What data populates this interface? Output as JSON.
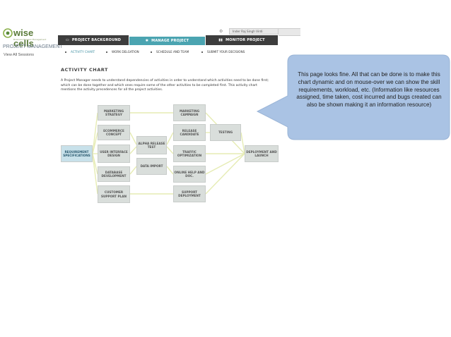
{
  "brand": {
    "logo_text": "wise cells",
    "tagline": "Business Process Management",
    "app_title": "PROJECT MANAGEMENT",
    "sessions_link": "View All Sessions"
  },
  "user": {
    "name": "Inder Raj Singh Virdi"
  },
  "tabs": [
    {
      "label": "PROJECT BACKGROUND",
      "icon": "monitor-icon"
    },
    {
      "label": "MANAGE PROJECT",
      "icon": "gear-icon"
    },
    {
      "label": "MONITOR PROJECT",
      "icon": "bar-chart-icon"
    }
  ],
  "subnav": [
    "ACTIVITY CHART",
    "WORK DELGATION",
    "SCHEDULE AND TEAM",
    "SUBMIT YOUR DECISIONS"
  ],
  "page": {
    "title": "ACTIVITY CHART",
    "description": "A Project Manager needs to understand dependencies of activities in order to understand which activities need to be done first; which can be done together and which ones require some of the other activities to be completed first. This activity chart mentions the activity precedences for all the project activities."
  },
  "activities": {
    "req": "REQUIREMENT SPECIFICATIONS",
    "mkt_strategy": "MARKETING STRATEGY",
    "ecom": "ECOMMERCE CONCEPT",
    "ui": "USER INTERFACE DESIGN",
    "db": "DATABASE DEVELOPMENT",
    "cust_support": "CUSTOMER SUPPORT PLAN",
    "alpha": "ALPHA RELEASE TEST",
    "data_import": "DATA IMPORT",
    "mkt_campaign": "MARKETING CAMPAIGN",
    "release": "RELEASE CANDIDATE",
    "traffic": "TRAFFIC OPTIMIZATION",
    "online_help": "ONLINE HELP AND DOC.",
    "support_deploy": "SUPPORT DEPLOYMENT",
    "testing": "TESTING",
    "deploy": "DEPLOYMENT AND LAUNCH"
  },
  "callout": {
    "text": "This page looks fine. All that can be done is to make this chart dynamic and on mouse-over we can show  the skill requirements, workload, etc. (Information like resources assigned, time taken, cost incurred and bugs created can also be shown making it an information resource)"
  },
  "colors": {
    "tab_dark": "#3d3d3d",
    "tab_active": "#4ba4b1",
    "callout_fill": "#aac3e4",
    "box": "#d9dedb",
    "start_box": "#c8e1ea",
    "connector": "#e6ecb4"
  }
}
